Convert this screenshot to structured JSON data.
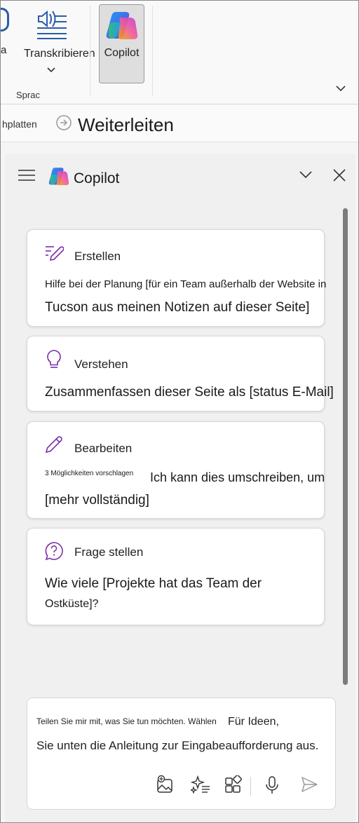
{
  "ribbon": {
    "dictate_label_partial": "a",
    "transcribe_label": "Transkribieren",
    "group_label": "Sprac",
    "copilot_label": "Copilot"
  },
  "message_bar": {
    "left_text": "hplatten",
    "forward_label": "Weiterleiten"
  },
  "pane": {
    "title": "Copilot",
    "cards": [
      {
        "title": "Erstellen",
        "icon": "edit-doc-icon",
        "line1": "Hilfe bei der Planung [für ein Team außerhalb der Website in",
        "line2": "Tucson aus meinen Notizen auf dieser Seite]"
      },
      {
        "title": "Verstehen",
        "icon": "lightbulb-icon",
        "line1": "Zusammenfassen dieser Seite als [status E-Mail]"
      },
      {
        "title": "Bearbeiten",
        "icon": "pencil-icon",
        "line1_small": "3 Möglichkeiten vorschlagen",
        "line1_rest": "Ich kann dies umschreiben, um",
        "line2": "[mehr vollständig]"
      },
      {
        "title": "Frage stellen",
        "icon": "question-bubble-icon",
        "line1": "Wie viele [Projekte hat das Team der",
        "line2": "Ostküste]?"
      }
    ],
    "compose": {
      "placeholder_small": "Teilen Sie mir mit, was Sie tun möchten. Wählen",
      "placeholder_rest": "Für Ideen,",
      "placeholder_line2": "Sie unten die Anleitung zur Eingabeaufforderung aus."
    }
  },
  "colors": {
    "accent_purple": "#7a2fa8",
    "mic_blue": "#2a5caa"
  }
}
